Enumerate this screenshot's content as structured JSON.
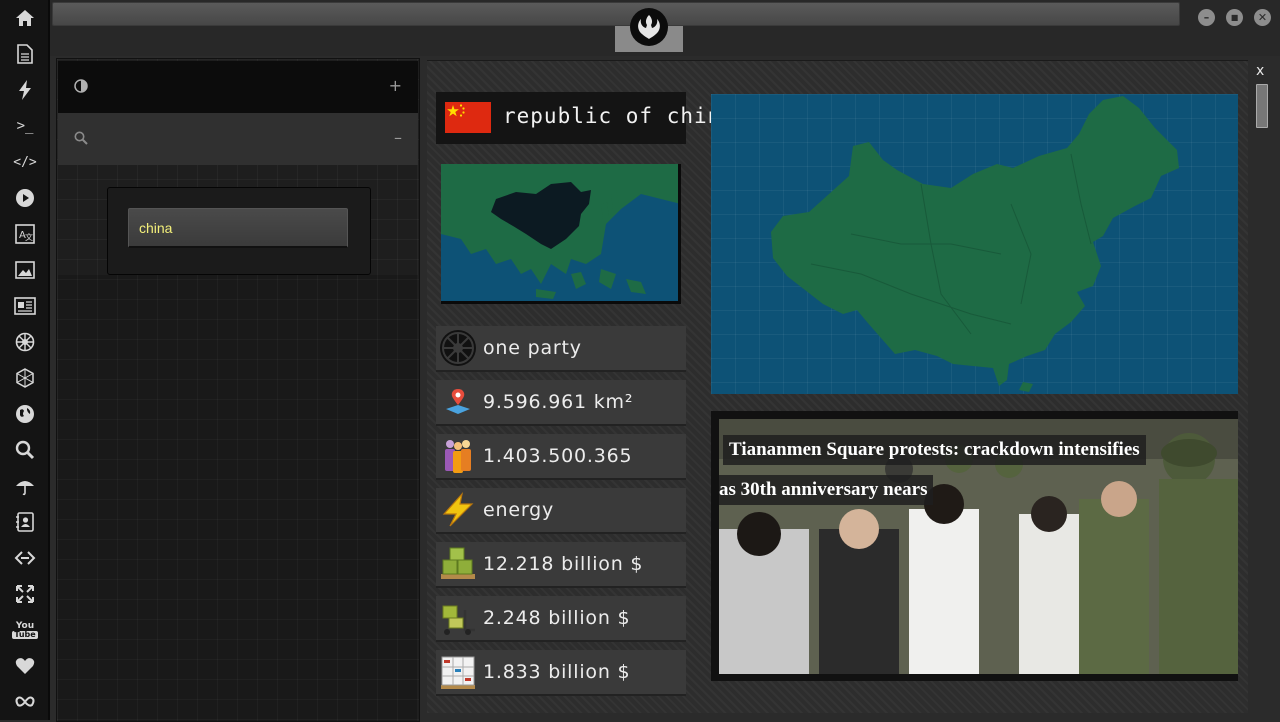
{
  "sidebar": {
    "items": [
      {
        "name": "home-icon",
        "glyph": "⌂"
      },
      {
        "name": "document-icon",
        "glyph": "🗎"
      },
      {
        "name": "lightning-icon",
        "glyph": "⚡"
      },
      {
        "name": "terminal-icon",
        "glyph": ">_"
      },
      {
        "name": "code-icon",
        "glyph": "</>"
      },
      {
        "name": "play-icon",
        "glyph": "▶"
      },
      {
        "name": "translate-icon",
        "glyph": "文"
      },
      {
        "name": "image-icon",
        "glyph": "▣"
      },
      {
        "name": "newspaper-icon",
        "glyph": "▤"
      },
      {
        "name": "galactic-empire-icon",
        "glyph": "✹"
      },
      {
        "name": "hexagon-icon",
        "glyph": "⬡"
      },
      {
        "name": "globe-icon",
        "glyph": "◍"
      },
      {
        "name": "search-icon",
        "glyph": "⚲"
      },
      {
        "name": "umbrella-icon",
        "glyph": "☂"
      },
      {
        "name": "contacts-icon",
        "glyph": "▦"
      },
      {
        "name": "link-icon",
        "glyph": "◇"
      },
      {
        "name": "expand-icon",
        "glyph": "✥"
      },
      {
        "name": "youtube-icon",
        "glyph": "You"
      },
      {
        "name": "heart-icon",
        "glyph": "♥"
      },
      {
        "name": "infinity-icon",
        "glyph": "∞"
      }
    ]
  },
  "window": {
    "close_x": "x",
    "controls": {
      "minimize": "–",
      "maximize": "■",
      "close": "✕"
    }
  },
  "left_panel": {
    "search_value": "china",
    "theme_action": "+",
    "search_action": "–"
  },
  "country": {
    "name": "republic of china",
    "flag_colors": {
      "field": "#de2910",
      "stars": "#ffde00"
    },
    "stats": [
      {
        "icon": "galactic-empire-icon",
        "text": "one party"
      },
      {
        "icon": "map-pin-icon",
        "text": "9.596.961 km²"
      },
      {
        "icon": "population-icon",
        "text": "1.403.500.365"
      },
      {
        "icon": "energy-icon",
        "text": "energy"
      },
      {
        "icon": "import-crates-icon",
        "text": "12.218 billion $"
      },
      {
        "icon": "forklift-crates-icon",
        "text": "2.248 billion $"
      },
      {
        "icon": "parcel-boxes-icon",
        "text": "1.833 billion $"
      }
    ]
  },
  "news": {
    "headline_line1": "Tiananmen Square protests: crackdown intensifies",
    "headline_line2": "as 30th anniversary nears"
  },
  "colors": {
    "ocean": "#0d5276",
    "land_green": "#1e6b45",
    "search_text": "#f4f07a"
  }
}
